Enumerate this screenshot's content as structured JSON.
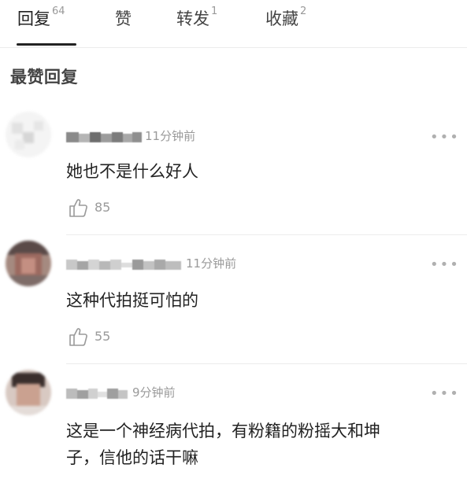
{
  "tabs": [
    {
      "label": "回复",
      "count": "64"
    },
    {
      "label": "赞",
      "count": ""
    },
    {
      "label": "转发",
      "count": "1"
    },
    {
      "label": "收藏",
      "count": "2"
    }
  ],
  "section_title": "最赞回复",
  "comments": [
    {
      "time": "11分钟前",
      "content": "她也不是什么好人",
      "likes": "85"
    },
    {
      "time": "11分钟前",
      "content": "这种代拍挺可怕的",
      "likes": "55"
    },
    {
      "time": "9分钟前",
      "content_line1": "这是一个神经病代拍，有粉籍的粉摇大和坤",
      "content_line2": "子，信他的话干嘛"
    }
  ],
  "more_label": "•••"
}
